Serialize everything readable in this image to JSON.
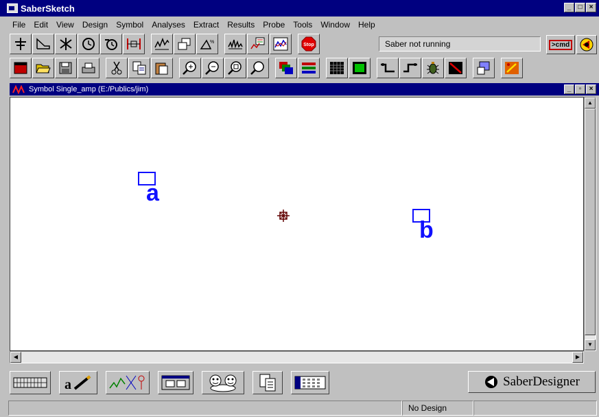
{
  "app": {
    "title": "SaberSketch"
  },
  "menu": [
    "File",
    "Edit",
    "View",
    "Design",
    "Symbol",
    "Analyses",
    "Extract",
    "Results",
    "Probe",
    "Tools",
    "Window",
    "Help"
  ],
  "toolbar": {
    "status_text": "Saber not running",
    "cmd_label": ">cmd",
    "stop_label": "Stop",
    "row1_icons": [
      "ground-icon",
      "wire-shape-icon",
      "star-symbol-icon",
      "clock-icon",
      "timer-icon",
      "component-icon",
      "waveform-icon",
      "copy-shape-icon",
      "triangle-shape-icon",
      "sweep-icon",
      "graph-window-icon",
      "chart-icon",
      "stop-icon"
    ],
    "row2_icons": [
      "new-file-icon",
      "open-folder-icon",
      "save-icon",
      "print-icon",
      "cut-icon",
      "copy-icon",
      "paste-icon",
      "zoom-in-icon",
      "zoom-out-icon",
      "zoom-fit-icon",
      "zoom-window-icon",
      "layers-icon",
      "color-bars-icon",
      "grid-icon",
      "green-box-icon",
      "step-icon",
      "step-alt-icon",
      "bug-icon",
      "line-icon",
      "help-icon",
      "palette-icon"
    ]
  },
  "document": {
    "title": "Symbol Single_amp (E:/Publics/jim)",
    "pins": [
      {
        "label": "a"
      },
      {
        "label": "b"
      }
    ]
  },
  "bottom_tools": [
    "keyboard-icon",
    "text-edit-icon",
    "schematic-icon",
    "window-icon",
    "faces-icon",
    "pages-icon",
    "grid-table-icon"
  ],
  "brand": {
    "name": "SaberDesigner"
  },
  "statusbar": {
    "design": "No Design"
  },
  "colors": {
    "titlebar": "#000080",
    "pin": "#1010ff",
    "face": "#c0c0c0"
  }
}
